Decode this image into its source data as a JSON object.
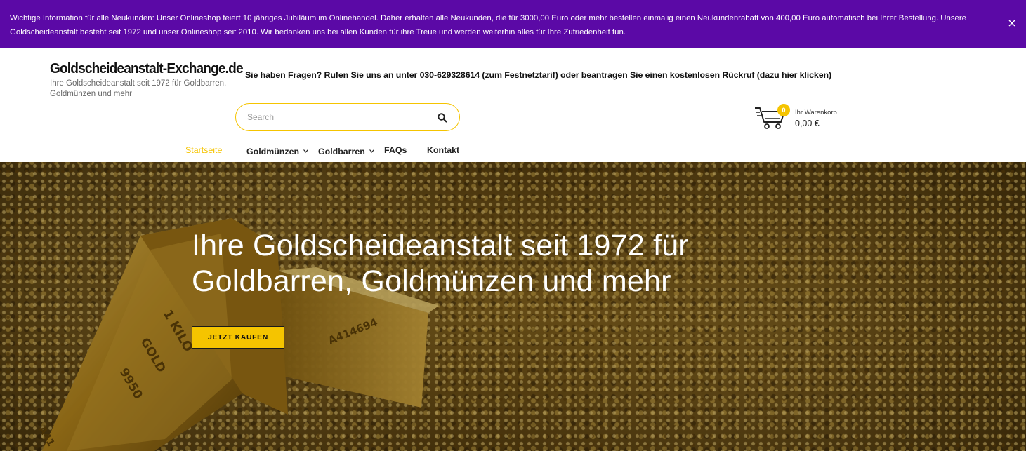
{
  "notice": {
    "text": "Wichtige Information für alle Neukunden: Unser Onlineshop feiert 10 jähriges Jubiläum im Onlinehandel. Daher erhalten alle Neukunden, die für 3000,00 Euro oder mehr bestellen einmalig einen Neukundenrabatt von 400,00 Euro automatisch bei Ihrer Bestellung. Unsere Goldscheideanstalt besteht seit 1972 und unser Onlineshop seit 2010. Wir bedanken uns bei allen Kunden für ihre Treue und werden weiterhin alles für Ihre Zufriedenheit tun.",
    "background_color": "#5b09a6",
    "close_icon": "close-icon"
  },
  "header": {
    "logo_title": "Goldscheideanstalt-Exchange.de",
    "logo_tagline": "Ihre Goldscheideanstalt seit 1972 für Goldbarren, Goldmünzen und mehr",
    "contact_text": "Sie haben Fragen? Rufen Sie uns an unter 030-629328614 (zum Festnetztarif) oder beantragen Sie einen kostenlosen Rückruf (dazu hier klicken)"
  },
  "search": {
    "placeholder": "Search",
    "icon": "search-icon",
    "border_color": "#f5c400"
  },
  "cart": {
    "icon": "cart-icon",
    "count": "0",
    "label": "Ihr Warenkorb",
    "total": "0,00 €"
  },
  "nav": {
    "items": [
      {
        "label": "Startseite",
        "active": true
      },
      {
        "label": "Goldmünzen",
        "dropdown": true
      },
      {
        "label": "Goldbarren",
        "dropdown": true
      },
      {
        "label": "FAQs"
      },
      {
        "label": "Kontakt"
      }
    ],
    "active_color": "#f5c400"
  },
  "hero": {
    "title": "Ihre Goldscheideanstalt seit 1972 für Goldbarren, Goldmünzen und mehr",
    "button_label": "JETZT KAUFEN",
    "button_color": "#f5c400",
    "bar_engraving": [
      "1 KILO",
      "GOLD",
      "9950",
      "A414694",
      "A41"
    ]
  }
}
